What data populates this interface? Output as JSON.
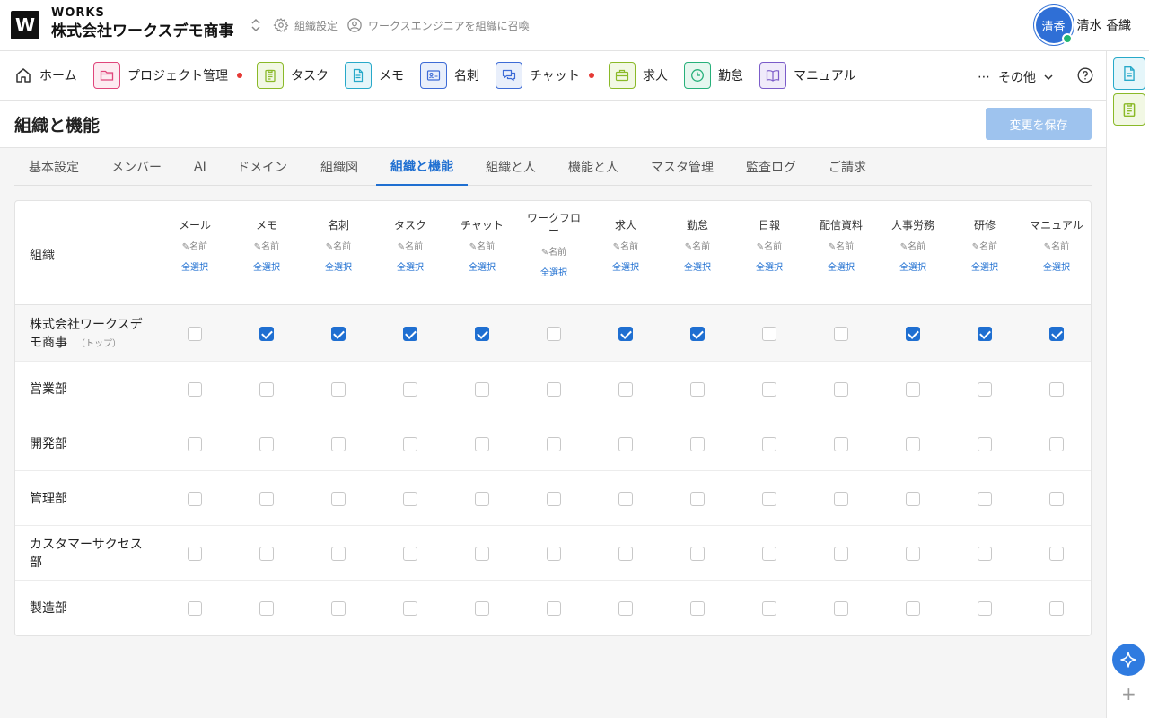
{
  "header": {
    "logo_letter": "W",
    "brand_sub": "WORKS",
    "company": "株式会社ワークスデモ商事",
    "org_settings": "組織設定",
    "invite": "ワークスエンジニアを組織に召喚",
    "avatar_text": "清香",
    "user_name": "清水 香織"
  },
  "nav": {
    "items": [
      {
        "label": "ホーム",
        "icon": "home-icon"
      },
      {
        "label": "プロジェクト管理",
        "icon": "folder-icon",
        "color": "#e0457b"
      },
      {
        "label": "タスク",
        "icon": "clipboard-icon",
        "color": "#8ab928"
      },
      {
        "label": "メモ",
        "icon": "document-icon",
        "color": "#27a9c9"
      },
      {
        "label": "名刺",
        "icon": "id-card-icon",
        "color": "#3d6bd6"
      },
      {
        "label": "チャット",
        "icon": "chat-icon",
        "color": "#3d6bd6"
      },
      {
        "label": "求人",
        "icon": "briefcase-icon",
        "color": "#8ab928"
      },
      {
        "label": "勤怠",
        "icon": "clock-icon",
        "color": "#27b07a"
      },
      {
        "label": "マニュアル",
        "icon": "book-icon",
        "color": "#7b5cc9"
      }
    ],
    "more": "その他"
  },
  "page": {
    "title": "組織と機能",
    "save": "変更を保存"
  },
  "tabs": [
    "基本設定",
    "メンバー",
    "AI",
    "ドメイン",
    "組織図",
    "組織と機能",
    "組織と人",
    "機能と人",
    "マスタ管理",
    "監査ログ",
    "ご請求"
  ],
  "active_tab": "組織と機能",
  "table": {
    "org_header": "組織",
    "rename": "✎名前",
    "select_all": "全選択",
    "columns": [
      "メール",
      "メモ",
      "名刺",
      "タスク",
      "チャット",
      "ワークフロー",
      "求人",
      "勤怠",
      "日報",
      "配信資料",
      "人事労務",
      "研修",
      "マニュアル"
    ],
    "rows": [
      {
        "name": "株式会社ワークスデモ商事",
        "tag": "（トップ）",
        "checks": [
          false,
          true,
          true,
          true,
          true,
          false,
          true,
          true,
          false,
          false,
          true,
          true,
          true
        ]
      },
      {
        "name": "営業部",
        "checks": [
          false,
          false,
          false,
          false,
          false,
          false,
          false,
          false,
          false,
          false,
          false,
          false,
          false
        ]
      },
      {
        "name": "開発部",
        "checks": [
          false,
          false,
          false,
          false,
          false,
          false,
          false,
          false,
          false,
          false,
          false,
          false,
          false
        ]
      },
      {
        "name": "管理部",
        "checks": [
          false,
          false,
          false,
          false,
          false,
          false,
          false,
          false,
          false,
          false,
          false,
          false,
          false
        ]
      },
      {
        "name": "カスタマーサクセス部",
        "checks": [
          false,
          false,
          false,
          false,
          false,
          false,
          false,
          false,
          false,
          false,
          false,
          false,
          false
        ]
      },
      {
        "name": "製造部",
        "checks": [
          false,
          false,
          false,
          false,
          false,
          false,
          false,
          false,
          false,
          false,
          false,
          false,
          false
        ]
      }
    ]
  }
}
